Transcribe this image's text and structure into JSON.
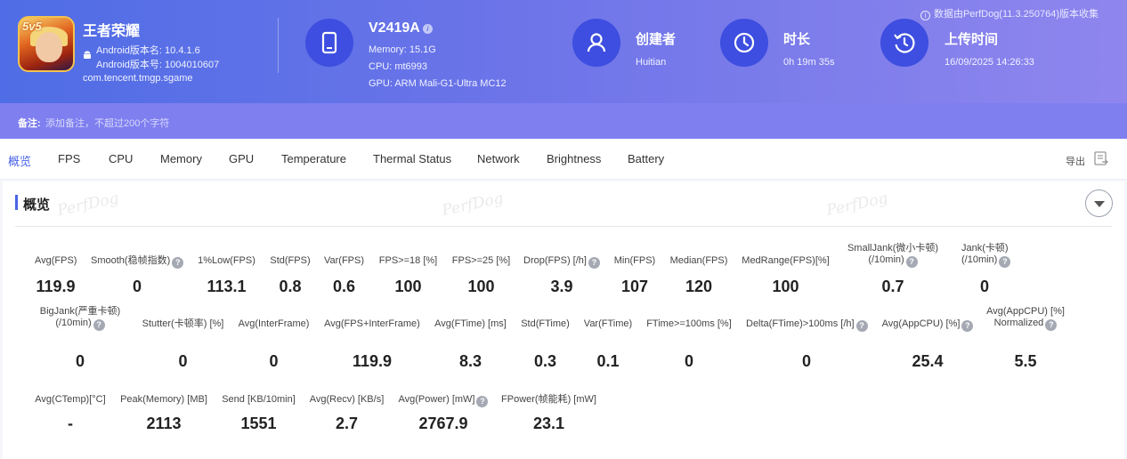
{
  "header": {
    "data_source": "数据由PerfDog(11.3.250764)版本收集",
    "app": {
      "name": "王者荣耀",
      "icon_text": "5v5",
      "version_name": "Android版本名: 10.4.1.6",
      "version_code": "Android版本号: 1004010607",
      "package": "com.tencent.tmgp.sgame"
    },
    "device": {
      "name": "V2419A",
      "memory": "Memory: 15.1G",
      "cpu": "CPU: mt6993",
      "gpu": "GPU: ARM Mali-G1-Ultra MC12"
    },
    "creator": {
      "title": "创建者",
      "value": "Huitian"
    },
    "duration": {
      "title": "时长",
      "value": "0h 19m 35s"
    },
    "upload": {
      "title": "上传时间",
      "value": "16/09/2025 14:26:33"
    }
  },
  "note": {
    "label": "备注:",
    "placeholder": "添加备注，不超过200个字符"
  },
  "tabs": [
    "概览",
    "FPS",
    "CPU",
    "Memory",
    "GPU",
    "Temperature",
    "Thermal Status",
    "Network",
    "Brightness",
    "Battery"
  ],
  "toolbar": {
    "export_label": "导出"
  },
  "section": {
    "title": "概览",
    "watermark": "PerfDog"
  },
  "rows": [
    [
      {
        "label": "Avg(FPS)",
        "value": "119.9",
        "help": false
      },
      {
        "label": "Smooth(稳帧指数)",
        "value": "0",
        "help": true
      },
      {
        "label": "1%Low(FPS)",
        "value": "113.1",
        "help": false
      },
      {
        "label": "Std(FPS)",
        "value": "0.8",
        "help": false
      },
      {
        "label": "Var(FPS)",
        "value": "0.6",
        "help": false
      },
      {
        "label": "FPS>=18 [%]",
        "value": "100",
        "help": false
      },
      {
        "label": "FPS>=25 [%]",
        "value": "100",
        "help": false
      },
      {
        "label": "Drop(FPS) [/h]",
        "value": "3.9",
        "help": true
      },
      {
        "label": "Min(FPS)",
        "value": "107",
        "help": false
      },
      {
        "label": "Median(FPS)",
        "value": "120",
        "help": false
      },
      {
        "label": "MedRange(FPS)[%]",
        "value": "100",
        "help": false
      },
      {
        "label": "SmallJank(微小卡顿)",
        "label2": "(/10min)",
        "value": "0.7",
        "help": true
      },
      {
        "label": "Jank(卡顿)",
        "label2": "(/10min)",
        "value": "0",
        "help": true
      }
    ],
    [
      {
        "label": "BigJank(严重卡顿)",
        "label2": "(/10min)",
        "value": "0",
        "help": true
      },
      {
        "label": "Stutter(卡顿率) [%]",
        "value": "0",
        "help": false
      },
      {
        "label": "Avg(InterFrame)",
        "value": "0",
        "help": false
      },
      {
        "label": "Avg(FPS+InterFrame)",
        "value": "119.9",
        "help": false
      },
      {
        "label": "Avg(FTime) [ms]",
        "value": "8.3",
        "help": false
      },
      {
        "label": "Std(FTime)",
        "value": "0.3",
        "help": false
      },
      {
        "label": "Var(FTime)",
        "value": "0.1",
        "help": false
      },
      {
        "label": "FTime>=100ms [%]",
        "value": "0",
        "help": false
      },
      {
        "label": "Delta(FTime)>100ms [/h]",
        "value": "0",
        "help": true
      },
      {
        "label": "Avg(AppCPU) [%]",
        "value": "25.4",
        "help": true
      },
      {
        "label": "Avg(AppCPU) [%]",
        "label2": "Normalized",
        "value": "5.5",
        "help": true
      }
    ],
    [
      {
        "label": "Avg(CTemp)[°C]",
        "value": "-",
        "help": false
      },
      {
        "label": "Peak(Memory) [MB]",
        "value": "2113",
        "help": false
      },
      {
        "label": "Send [KB/10min]",
        "value": "1551",
        "help": false
      },
      {
        "label": "Avg(Recv) [KB/s]",
        "value": "2.7",
        "help": false
      },
      {
        "label": "Avg(Power) [mW]",
        "value": "2767.9",
        "help": true
      },
      {
        "label": "FPower(帧能耗) [mW]",
        "value": "23.1",
        "help": false
      }
    ]
  ]
}
